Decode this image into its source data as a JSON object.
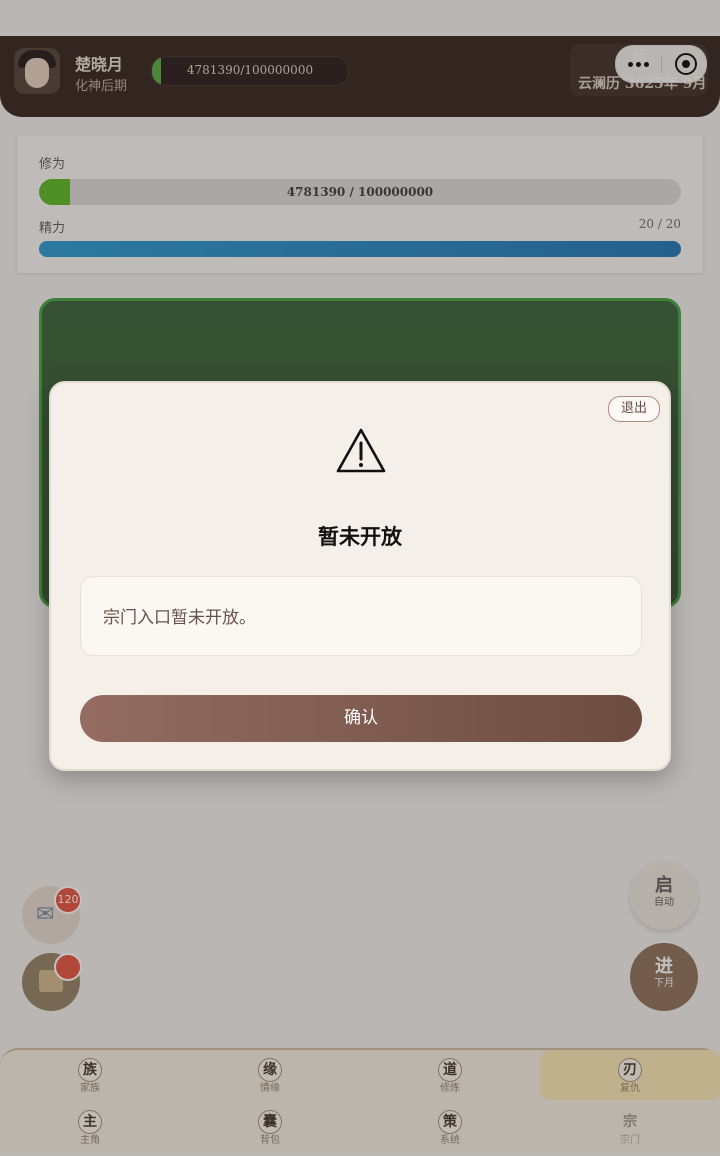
{
  "header": {
    "player_name": "楚晓月",
    "player_realm": "化神后期",
    "cultivation_short": "4781390/100000000",
    "cultivation_progress": 0.048,
    "calendar_icon_char": "历",
    "calendar_label": "云澜历 3625年 9月"
  },
  "stats": {
    "cultivation_label": "修为",
    "cultivation_text": "4781390 / 100000000",
    "cultivation_progress": 0.048,
    "energy_label": "精力",
    "energy_value": "20 / 20",
    "energy_progress": 1.0
  },
  "floating": {
    "mail_badge": "120",
    "auto_title": "启",
    "auto_sub": "自动",
    "next_title": "进",
    "next_sub": "下月"
  },
  "nav": {
    "items": [
      {
        "char": "族",
        "label": "家族"
      },
      {
        "char": "缘",
        "label": "情缘"
      },
      {
        "char": "道",
        "label": "修炼"
      },
      {
        "char": "刃",
        "label": "复仇"
      },
      {
        "char": "主",
        "label": "主角"
      },
      {
        "char": "囊",
        "label": "背包"
      },
      {
        "char": "策",
        "label": "系统"
      },
      {
        "char": "宗",
        "label": "宗门"
      }
    ]
  },
  "modal": {
    "exit_label": "退出",
    "title": "暂未开放",
    "message": "宗门入口暂未开放。",
    "confirm_label": "确认"
  },
  "colors": {
    "header_bg": "#2a1a16",
    "xp_green": "#55b51c",
    "energy_blue": "#1671b5",
    "confirm_brown": "#7d5b4f",
    "badge_red": "#e54a3a",
    "nav_active": "#f6e7b4"
  },
  "icons": {
    "warning": "warning-triangle-icon",
    "mail": "mail-icon",
    "scroll": "scroll-icon",
    "more": "more-dots-icon",
    "close": "capsule-close-icon"
  }
}
